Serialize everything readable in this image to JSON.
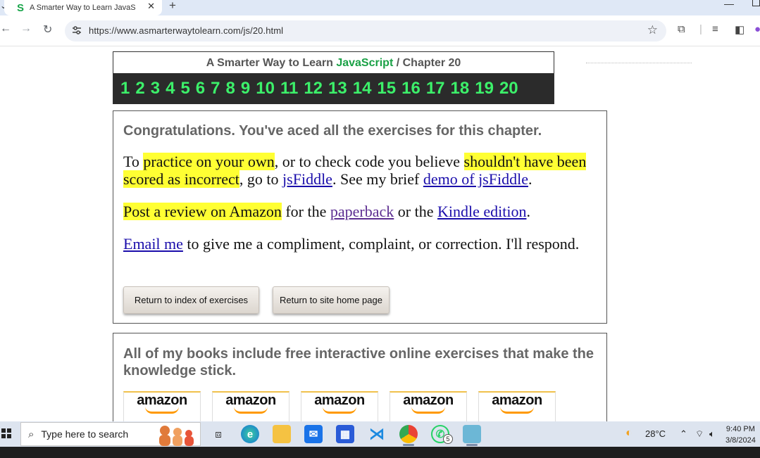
{
  "browser": {
    "tab_title": "A Smarter Way to Learn JavaScr",
    "tab_favicon": "S",
    "new_tab": "+",
    "close_tab": "✕",
    "url": "https://www.asmarterwaytolearn.com/js/20.html"
  },
  "page": {
    "header": {
      "prefix": "A Smarter Way to Learn ",
      "brand": "JavaScript",
      "separator": " / ",
      "chapter": "Chapter 20",
      "chapter_numbers": [
        "1",
        "2",
        "3",
        "4",
        "5",
        "6",
        "7",
        "8",
        "9",
        "10",
        "11",
        "12",
        "13",
        "14",
        "15",
        "16",
        "17",
        "18",
        "19",
        "20"
      ]
    },
    "congrats": {
      "heading": "Congratulations. You've aced all the exercises for this chapter.",
      "p1_a": "To ",
      "p1_hl1": "practice on your own",
      "p1_b": ", or to check code you believe ",
      "p1_hl2": "shouldn't have been scored as incorrect",
      "p1_c": ", go to ",
      "p1_link1": "jsFiddle",
      "p1_d": ". See my brief ",
      "p1_link2": "demo of jsFiddle",
      "p1_e": ".",
      "p2_hl": "Post a review on Amazon",
      "p2_a": " for the ",
      "p2_link1": "paperback",
      "p2_b": " or the ",
      "p2_link2": "Kindle edition",
      "p2_c": ".",
      "p3_link": "Email me",
      "p3_a": " to give me a compliment, complaint, or correction. I'll respond.",
      "btn_index": "Return to index of exercises",
      "btn_home": "Return to site home page"
    },
    "books": {
      "heading": " All of my books include free interactive online exercises that make the knowledge stick.",
      "amazon_labels": [
        "amazon",
        "amazon",
        "amazon",
        "amazon",
        "amazon"
      ]
    }
  },
  "taskbar": {
    "search_placeholder": "Type here to search",
    "weather_temp": "28°C",
    "time": "9:40 PM",
    "date": "3/8/2024",
    "whatsapp_badge": "5"
  },
  "colors": {
    "brand_green": "#1aa146",
    "chapter_number_green": "#3cf06a",
    "highlight_yellow": "#ffff33",
    "link_blue": "#1a0dab",
    "visited_purple": "#5c2d91"
  }
}
